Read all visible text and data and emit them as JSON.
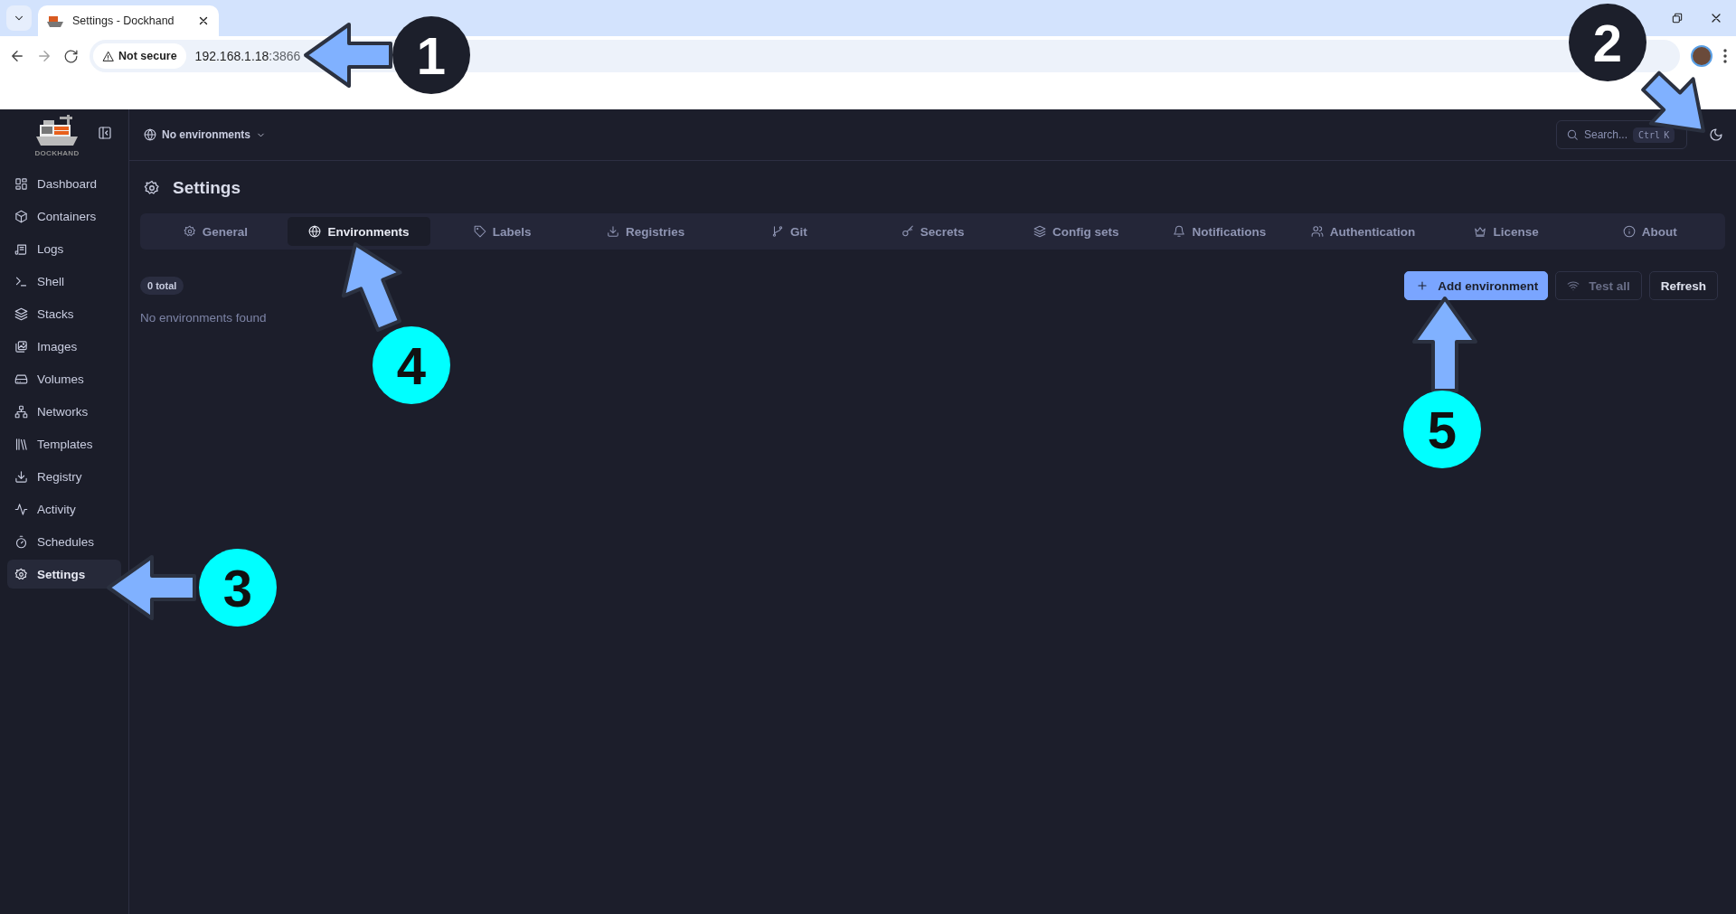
{
  "browser": {
    "tab_title": "Settings - Dockhand",
    "security": "Not secure",
    "url_host": "192.168.1.18",
    "url_port": ":3866"
  },
  "sidebar": {
    "logo_text": "DOCKHAND",
    "items": [
      {
        "label": "Dashboard",
        "selected": false
      },
      {
        "label": "Containers",
        "selected": false
      },
      {
        "label": "Logs",
        "selected": false
      },
      {
        "label": "Shell",
        "selected": false
      },
      {
        "label": "Stacks",
        "selected": false
      },
      {
        "label": "Images",
        "selected": false
      },
      {
        "label": "Volumes",
        "selected": false
      },
      {
        "label": "Networks",
        "selected": false
      },
      {
        "label": "Templates",
        "selected": false
      },
      {
        "label": "Registry",
        "selected": false
      },
      {
        "label": "Activity",
        "selected": false
      },
      {
        "label": "Schedules",
        "selected": false
      },
      {
        "label": "Settings",
        "selected": true
      }
    ]
  },
  "header": {
    "environment": "No environments",
    "search": {
      "placeholder": "Search...",
      "shortcut_1": "Ctrl",
      "shortcut_2": "K"
    }
  },
  "page": {
    "title": "Settings",
    "tabs": [
      {
        "label": "General",
        "selected": false
      },
      {
        "label": "Environments",
        "selected": true
      },
      {
        "label": "Labels",
        "selected": false
      },
      {
        "label": "Registries",
        "selected": false
      },
      {
        "label": "Git",
        "selected": false
      },
      {
        "label": "Secrets",
        "selected": false
      },
      {
        "label": "Config sets",
        "selected": false
      },
      {
        "label": "Notifications",
        "selected": false
      },
      {
        "label": "Authentication",
        "selected": false
      },
      {
        "label": "License",
        "selected": false
      },
      {
        "label": "About",
        "selected": false
      }
    ],
    "count": "0 total",
    "empty_text": "No environments found",
    "buttons": [
      {
        "label": "Add environment",
        "kind": "primary",
        "disabled": false
      },
      {
        "label": "Test all",
        "kind": "secondary",
        "disabled": true
      },
      {
        "label": "Refresh",
        "kind": "secondary",
        "disabled": false
      }
    ]
  },
  "annotations": [
    {
      "label": "1",
      "color": "#1c1f2b"
    },
    {
      "label": "2",
      "color": "#1c1f2b"
    },
    {
      "label": "3",
      "color": "#00ffff"
    },
    {
      "label": "4",
      "color": "#00ffff"
    },
    {
      "label": "5",
      "color": "#00ffff"
    }
  ]
}
